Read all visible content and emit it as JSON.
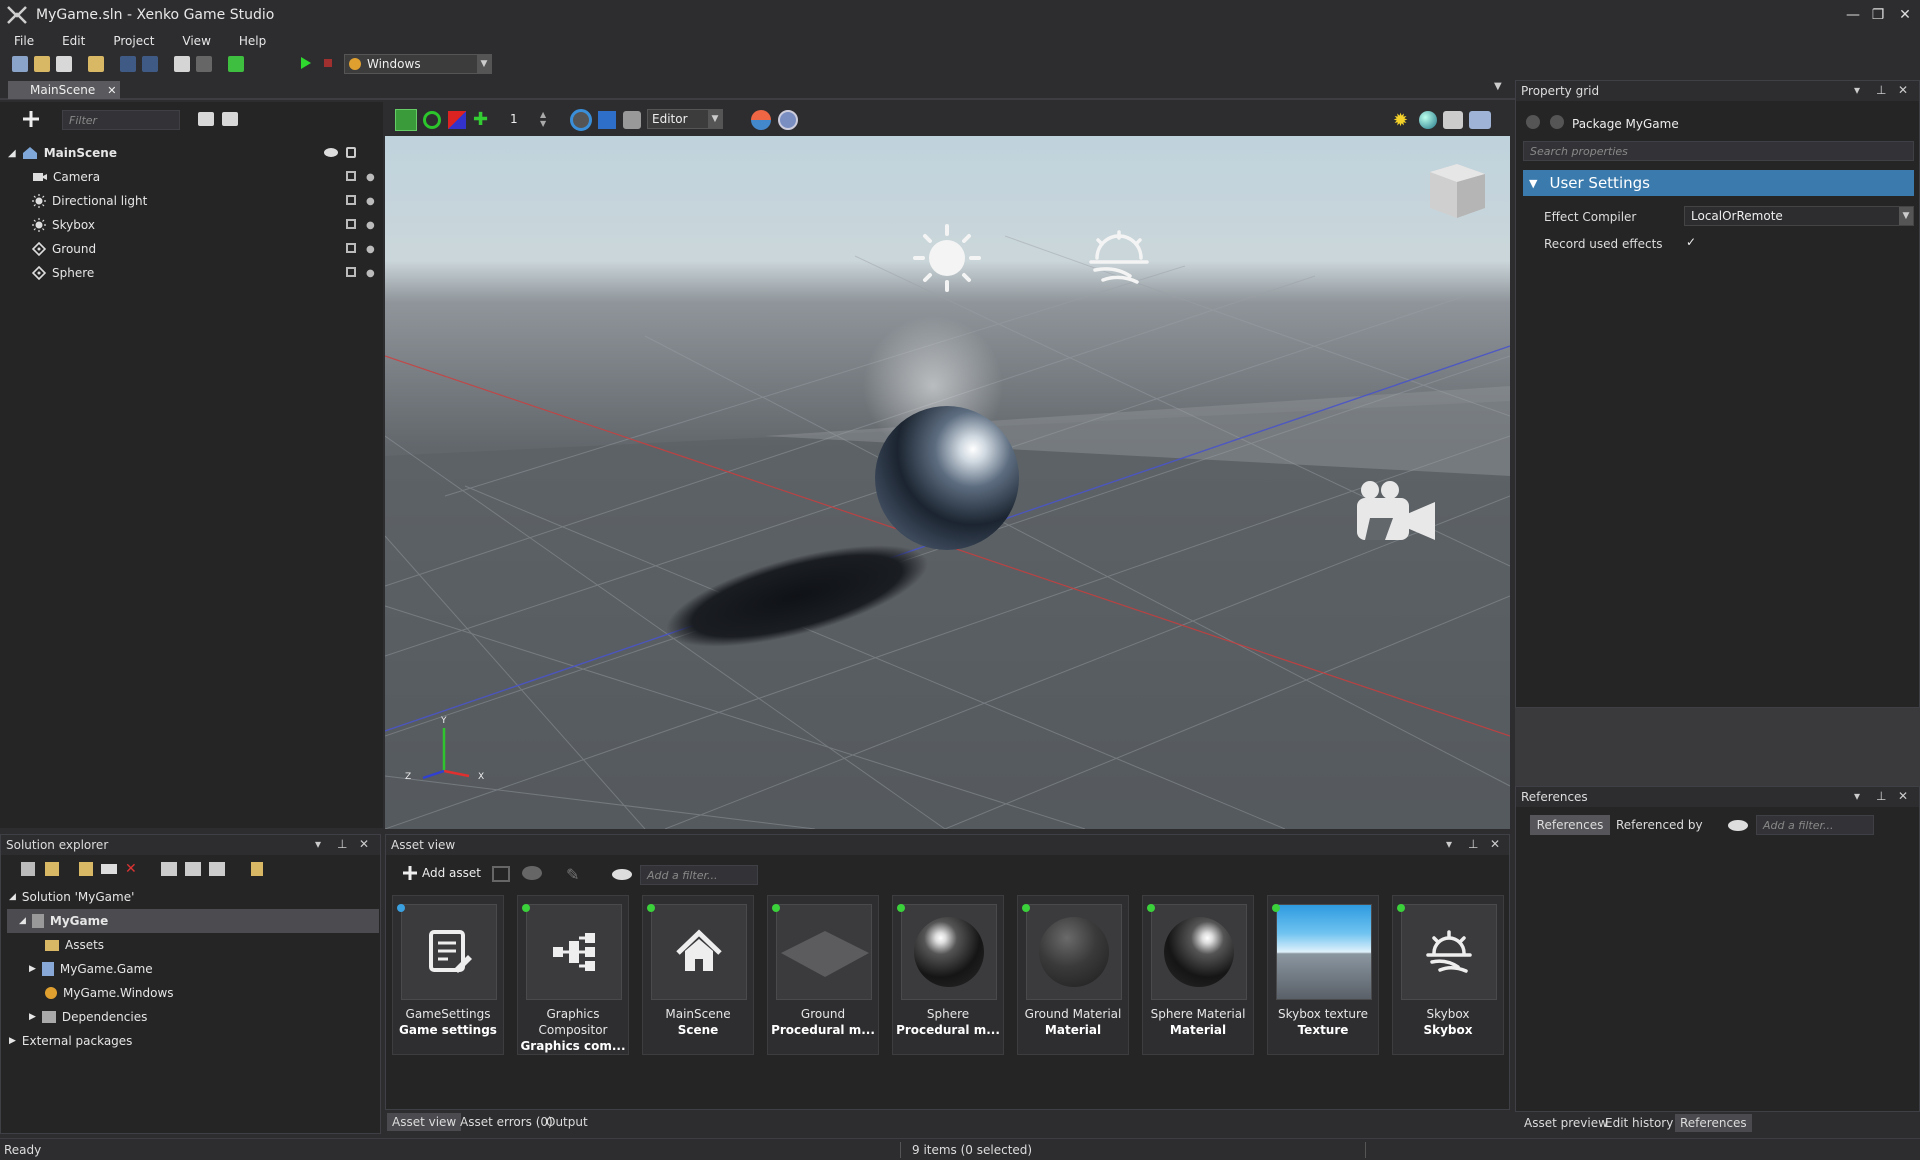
{
  "window": {
    "title": "MyGame.sln - Xenko Game Studio",
    "minimize": "—",
    "restore": "❐",
    "close": "✕"
  },
  "menu": [
    "File",
    "Edit",
    "Project",
    "View",
    "Help"
  ],
  "toolbar": {
    "platform": "Windows"
  },
  "scene_tab": {
    "label": "MainScene",
    "close": "✕"
  },
  "hierarchy": {
    "filter_placeholder": "Filter",
    "root": "MainScene",
    "items": [
      "Camera",
      "Directional light",
      "Skybox",
      "Ground",
      "Sphere"
    ]
  },
  "viewport_toolbar": {
    "snap_value": "1",
    "camera_mode": "Editor"
  },
  "property_grid": {
    "title": "Property grid",
    "package": "Package MyGame",
    "search_placeholder": "Search properties",
    "section": "User Settings",
    "effect_compiler_label": "Effect Compiler",
    "effect_compiler_value": "LocalOrRemote",
    "record_label": "Record used effects",
    "record_checked": true
  },
  "references": {
    "title": "References",
    "tab_references": "References",
    "tab_referenced_by": "Referenced by",
    "filter_placeholder": "Add a filter..."
  },
  "solution_explorer": {
    "title": "Solution explorer",
    "solution": "Solution 'MyGame'",
    "project": "MyGame",
    "children": [
      "Assets",
      "MyGame.Game",
      "MyGame.Windows",
      "Dependencies"
    ],
    "external": "External packages"
  },
  "asset_view": {
    "title": "Asset view",
    "add_asset": "Add asset",
    "filter_placeholder": "Add a filter...",
    "assets": [
      {
        "name": "GameSettings",
        "type": "Game settings",
        "icon": "settings-document-icon",
        "status": "blue"
      },
      {
        "name": "Graphics Compositor",
        "type": "Graphics com...",
        "icon": "graph-icon",
        "status": "green"
      },
      {
        "name": "MainScene",
        "type": "Scene",
        "icon": "house-icon",
        "status": "green"
      },
      {
        "name": "Ground",
        "type": "Procedural m...",
        "icon": "plane-thumbnail",
        "status": "green"
      },
      {
        "name": "Sphere",
        "type": "Procedural m...",
        "icon": "glossy-sphere-thumbnail",
        "status": "green"
      },
      {
        "name": "Ground Material",
        "type": "Material",
        "icon": "matte-sphere-thumbnail",
        "status": "green"
      },
      {
        "name": "Sphere Material",
        "type": "Material",
        "icon": "glossy-sphere-thumbnail",
        "status": "green"
      },
      {
        "name": "Skybox texture",
        "type": "Texture",
        "icon": "sky-texture-thumbnail",
        "status": "green"
      },
      {
        "name": "Skybox",
        "type": "Skybox",
        "icon": "skybox-sun-icon",
        "status": "green"
      }
    ],
    "bottom_tabs": [
      "Asset view",
      "Asset errors (0)",
      "Output"
    ]
  },
  "right_bottom_tabs": [
    "Asset preview",
    "Edit history",
    "References"
  ],
  "status": {
    "left": "Ready",
    "center": "9 items (0 selected)"
  }
}
